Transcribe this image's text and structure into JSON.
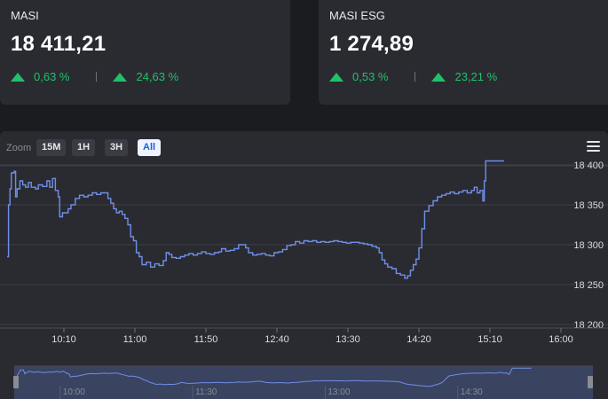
{
  "cards": [
    {
      "name": "MASI",
      "value": "18 411,21",
      "change_day": "0,63 %",
      "change_ytd": "24,63 %",
      "trend": "up"
    },
    {
      "name": "MASI ESG",
      "value": "1 274,89",
      "change_day": "0,53 %",
      "change_ytd": "23,21 %",
      "trend": "up"
    }
  ],
  "chart": {
    "zoom_label": "Zoom",
    "zoom_buttons": [
      {
        "label": "15M",
        "active": false
      },
      {
        "label": "1H",
        "active": false
      },
      {
        "label": "3H",
        "active": false
      },
      {
        "label": "All",
        "active": true
      }
    ],
    "menu_icon": "hamburger-menu-icon",
    "navigator_labels": [
      "10:00",
      "11:30",
      "13:00",
      "14:30"
    ],
    "colors": {
      "line": "#6f8fe8",
      "up": "#22c06b",
      "panel": "#2a2b31"
    }
  },
  "chart_data": {
    "type": "line",
    "x_ticks": [
      "10:10",
      "11:00",
      "11:50",
      "12:40",
      "13:30",
      "14:20",
      "15:10",
      "16:00"
    ],
    "y_ticks": [
      "18 200",
      "18 250",
      "18 300",
      "18 350",
      "18 400"
    ],
    "ylim": [
      18200,
      18400
    ],
    "xlim_minutes": [
      570,
      960
    ],
    "series": [
      {
        "values": [
          [
            570,
            18285
          ],
          [
            571,
            18350
          ],
          [
            572,
            18370
          ],
          [
            573,
            18390
          ],
          [
            575,
            18392
          ],
          [
            576,
            18360
          ],
          [
            577,
            18370
          ],
          [
            579,
            18380
          ],
          [
            581,
            18375
          ],
          [
            583,
            18372
          ],
          [
            585,
            18378
          ],
          [
            587,
            18372
          ],
          [
            590,
            18370
          ],
          [
            592,
            18375
          ],
          [
            595,
            18373
          ],
          [
            598,
            18380
          ],
          [
            600,
            18372
          ],
          [
            602,
            18383
          ],
          [
            604,
            18368
          ],
          [
            606,
            18360
          ],
          [
            607,
            18335
          ],
          [
            609,
            18340
          ],
          [
            611,
            18340
          ],
          [
            613,
            18345
          ],
          [
            615,
            18350
          ],
          [
            618,
            18358
          ],
          [
            621,
            18362
          ],
          [
            624,
            18360
          ],
          [
            627,
            18362
          ],
          [
            630,
            18365
          ],
          [
            633,
            18363
          ],
          [
            636,
            18365
          ],
          [
            639,
            18365
          ],
          [
            641,
            18358
          ],
          [
            643,
            18352
          ],
          [
            645,
            18345
          ],
          [
            647,
            18340
          ],
          [
            649,
            18342
          ],
          [
            651,
            18338
          ],
          [
            653,
            18333
          ],
          [
            655,
            18325
          ],
          [
            657,
            18310
          ],
          [
            659,
            18305
          ],
          [
            661,
            18290
          ],
          [
            663,
            18285
          ],
          [
            665,
            18275
          ],
          [
            668,
            18278
          ],
          [
            671,
            18272
          ],
          [
            674,
            18276
          ],
          [
            677,
            18274
          ],
          [
            680,
            18280
          ],
          [
            682,
            18290
          ],
          [
            684,
            18288
          ],
          [
            686,
            18284
          ],
          [
            689,
            18283
          ],
          [
            692,
            18285
          ],
          [
            695,
            18287
          ],
          [
            698,
            18289
          ],
          [
            701,
            18287
          ],
          [
            704,
            18289
          ],
          [
            707,
            18291
          ],
          [
            710,
            18289
          ],
          [
            713,
            18288
          ],
          [
            716,
            18290
          ],
          [
            719,
            18291
          ],
          [
            721,
            18295
          ],
          [
            724,
            18292
          ],
          [
            727,
            18293
          ],
          [
            730,
            18295
          ],
          [
            733,
            18300
          ],
          [
            736,
            18300
          ],
          [
            738,
            18296
          ],
          [
            740,
            18290
          ],
          [
            743,
            18287
          ],
          [
            746,
            18288
          ],
          [
            749,
            18289
          ],
          [
            752,
            18287
          ],
          [
            755,
            18286
          ],
          [
            758,
            18290
          ],
          [
            761,
            18291
          ],
          [
            764,
            18294
          ],
          [
            767,
            18299
          ],
          [
            770,
            18300
          ],
          [
            773,
            18304
          ],
          [
            776,
            18302
          ],
          [
            779,
            18305
          ],
          [
            782,
            18304
          ],
          [
            785,
            18305
          ],
          [
            788,
            18303
          ],
          [
            791,
            18304
          ],
          [
            794,
            18303
          ],
          [
            797,
            18304
          ],
          [
            800,
            18305
          ],
          [
            803,
            18304
          ],
          [
            806,
            18303
          ],
          [
            809,
            18302
          ],
          [
            812,
            18303
          ],
          [
            815,
            18303
          ],
          [
            818,
            18302
          ],
          [
            821,
            18301
          ],
          [
            824,
            18300
          ],
          [
            827,
            18298
          ],
          [
            830,
            18296
          ],
          [
            832,
            18290
          ],
          [
            834,
            18281
          ],
          [
            836,
            18276
          ],
          [
            838,
            18272
          ],
          [
            841,
            18270
          ],
          [
            844,
            18264
          ],
          [
            847,
            18262
          ],
          [
            850,
            18258
          ],
          [
            852,
            18261
          ],
          [
            854,
            18268
          ],
          [
            856,
            18275
          ],
          [
            858,
            18282
          ],
          [
            860,
            18296
          ],
          [
            862,
            18320
          ],
          [
            864,
            18342
          ],
          [
            867,
            18349
          ],
          [
            870,
            18355
          ],
          [
            873,
            18360
          ],
          [
            876,
            18362
          ],
          [
            879,
            18364
          ],
          [
            882,
            18366
          ],
          [
            885,
            18364
          ],
          [
            888,
            18366
          ],
          [
            891,
            18368
          ],
          [
            894,
            18365
          ],
          [
            897,
            18368
          ],
          [
            899,
            18372
          ],
          [
            901,
            18365
          ],
          [
            903,
            18368
          ],
          [
            905,
            18355
          ],
          [
            906,
            18380
          ],
          [
            907,
            18405
          ],
          [
            910,
            18405
          ],
          [
            913,
            18405
          ],
          [
            917,
            18405
          ],
          [
            920,
            18405
          ]
        ]
      }
    ]
  }
}
